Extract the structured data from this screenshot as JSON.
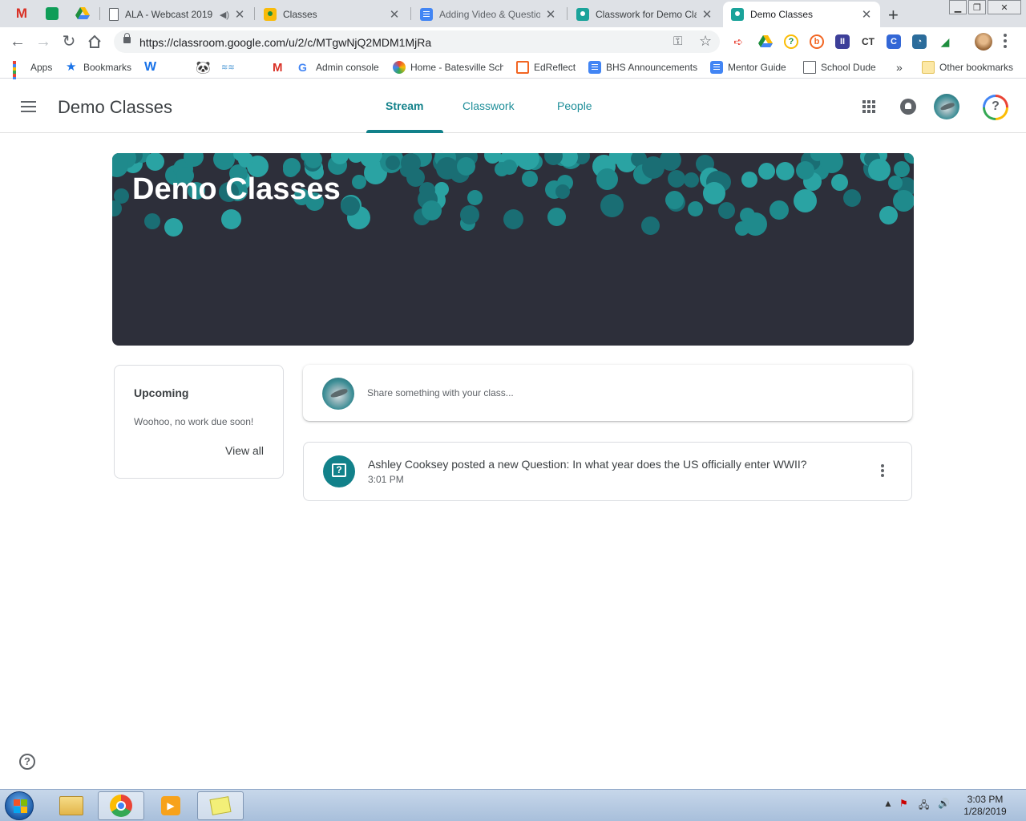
{
  "browser": {
    "tabs": [
      {
        "title": "ALA - Webcast 2019",
        "icon": "file-icon"
      },
      {
        "title": "Classes",
        "icon": "classroom-yellow-icon"
      },
      {
        "title": "Adding Video & Questions",
        "icon": "google-docs-icon"
      },
      {
        "title": "Classwork for Demo Classes",
        "icon": "classroom-icon"
      },
      {
        "title": "Demo Classes",
        "icon": "classroom-icon",
        "active": true
      }
    ],
    "url": "https://classroom.google.com/u/2/c/MTgwNjQ2MDM1MjRa",
    "bookmarks": [
      "Apps",
      "Bookmarks",
      "Admin console",
      "Home - Batesville Sch",
      "EdReflect",
      "BHS Announcements",
      "Mentor Guide",
      "School Dude",
      "Other bookmarks"
    ],
    "more_bookmarks": "»"
  },
  "classroom": {
    "class_name": "Demo Classes",
    "nav_tabs": [
      "Stream",
      "Classwork",
      "People"
    ],
    "active_tab": "Stream",
    "banner_title": "Demo Classes",
    "upcoming": {
      "title": "Upcoming",
      "message": "Woohoo, no work due soon!",
      "link": "View all"
    },
    "share_placeholder": "Share something with your class...",
    "posts": [
      {
        "text": "Ashley Cooksey posted a new Question: In what year does the US officially enter WWII?",
        "time": "3:01 PM"
      }
    ],
    "accent_color": "#12818a"
  },
  "taskbar": {
    "time": "3:03 PM",
    "date": "1/28/2019"
  }
}
